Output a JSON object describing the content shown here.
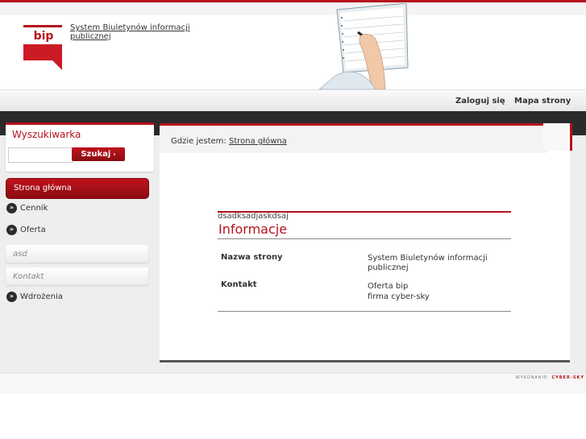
{
  "header": {
    "site_title": "System Biuletynów informacji publicznej",
    "logo_text": "bip"
  },
  "nav": {
    "login_label": "Zaloguj się",
    "sitemap_label": "Mapa strony"
  },
  "search": {
    "title": "Wyszukiwarka",
    "input_value": "",
    "button_label": "Szukaj"
  },
  "menu": {
    "active": "Strona główna",
    "items": [
      "Cennik",
      "Oferta"
    ],
    "subitems": [
      "asd",
      "Kontakt"
    ],
    "last_item": "Wdrożenia"
  },
  "breadcrumb": {
    "prefix": "Gdzie jestem:",
    "link": "Strona główna"
  },
  "content": {
    "subtitle": "dsadksadjaskdsaj",
    "heading": "Informacje",
    "rows": [
      {
        "label": "Nazwa strony",
        "value": "System Biuletynów informacji publicznej"
      },
      {
        "label": "Kontakt",
        "value_lines": [
          "Oferta bip",
          "firma cyber-sky"
        ]
      }
    ]
  },
  "footer": {
    "credits_prefix": "WYKONANIE:",
    "credits_name": "CYBER-SKY"
  },
  "colors": {
    "accent": "#b5121b",
    "dark_bar": "#2b2b2b",
    "background": "#eeeeee"
  }
}
